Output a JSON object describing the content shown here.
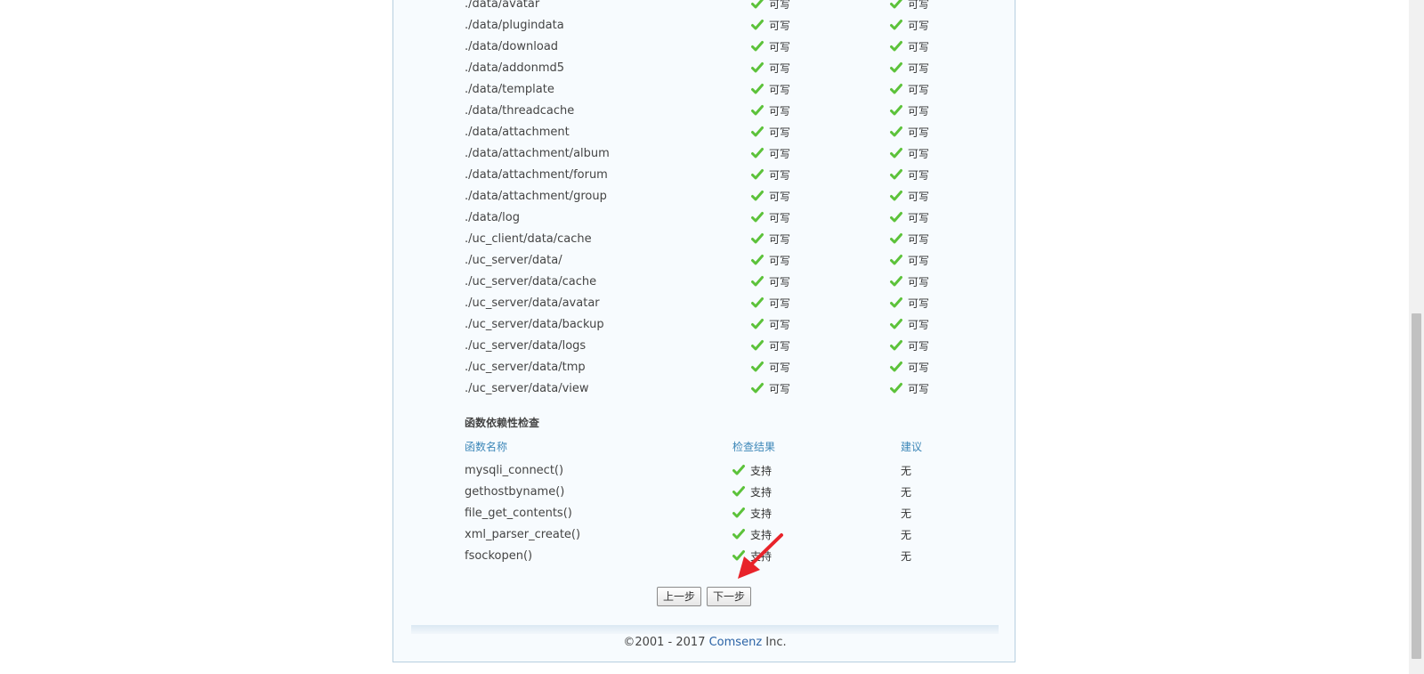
{
  "directory_check": {
    "rows": [
      {
        "path": "./data/avatar",
        "current": "可写",
        "required": "可写"
      },
      {
        "path": "./data/plugindata",
        "current": "可写",
        "required": "可写"
      },
      {
        "path": "./data/download",
        "current": "可写",
        "required": "可写"
      },
      {
        "path": "./data/addonmd5",
        "current": "可写",
        "required": "可写"
      },
      {
        "path": "./data/template",
        "current": "可写",
        "required": "可写"
      },
      {
        "path": "./data/threadcache",
        "current": "可写",
        "required": "可写"
      },
      {
        "path": "./data/attachment",
        "current": "可写",
        "required": "可写"
      },
      {
        "path": "./data/attachment/album",
        "current": "可写",
        "required": "可写"
      },
      {
        "path": "./data/attachment/forum",
        "current": "可写",
        "required": "可写"
      },
      {
        "path": "./data/attachment/group",
        "current": "可写",
        "required": "可写"
      },
      {
        "path": "./data/log",
        "current": "可写",
        "required": "可写"
      },
      {
        "path": "./uc_client/data/cache",
        "current": "可写",
        "required": "可写"
      },
      {
        "path": "./uc_server/data/",
        "current": "可写",
        "required": "可写"
      },
      {
        "path": "./uc_server/data/cache",
        "current": "可写",
        "required": "可写"
      },
      {
        "path": "./uc_server/data/avatar",
        "current": "可写",
        "required": "可写"
      },
      {
        "path": "./uc_server/data/backup",
        "current": "可写",
        "required": "可写"
      },
      {
        "path": "./uc_server/data/logs",
        "current": "可写",
        "required": "可写"
      },
      {
        "path": "./uc_server/data/tmp",
        "current": "可写",
        "required": "可写"
      },
      {
        "path": "./uc_server/data/view",
        "current": "可写",
        "required": "可写"
      }
    ]
  },
  "function_check": {
    "title": "函数依赖性检查",
    "headers": {
      "name": "函数名称",
      "result": "检查结果",
      "advice": "建议"
    },
    "rows": [
      {
        "name": "mysqli_connect()",
        "result": "支持",
        "advice": "无"
      },
      {
        "name": "gethostbyname()",
        "result": "支持",
        "advice": "无"
      },
      {
        "name": "file_get_contents()",
        "result": "支持",
        "advice": "无"
      },
      {
        "name": "xml_parser_create()",
        "result": "支持",
        "advice": "无"
      },
      {
        "name": "fsockopen()",
        "result": "支持",
        "advice": "无"
      }
    ]
  },
  "buttons": {
    "prev": "上一步",
    "next": "下一步"
  },
  "footer": {
    "copyright": "©2001 - 2017",
    "company": "Comsenz",
    "suffix": "Inc."
  },
  "colors": {
    "check_green": "#5cc23a",
    "header_blue": "#3d87b8",
    "link_blue": "#2b63a6",
    "arrow_red": "#e8232a"
  },
  "icons": {
    "check": "check-icon",
    "annotation": "red-arrow"
  }
}
